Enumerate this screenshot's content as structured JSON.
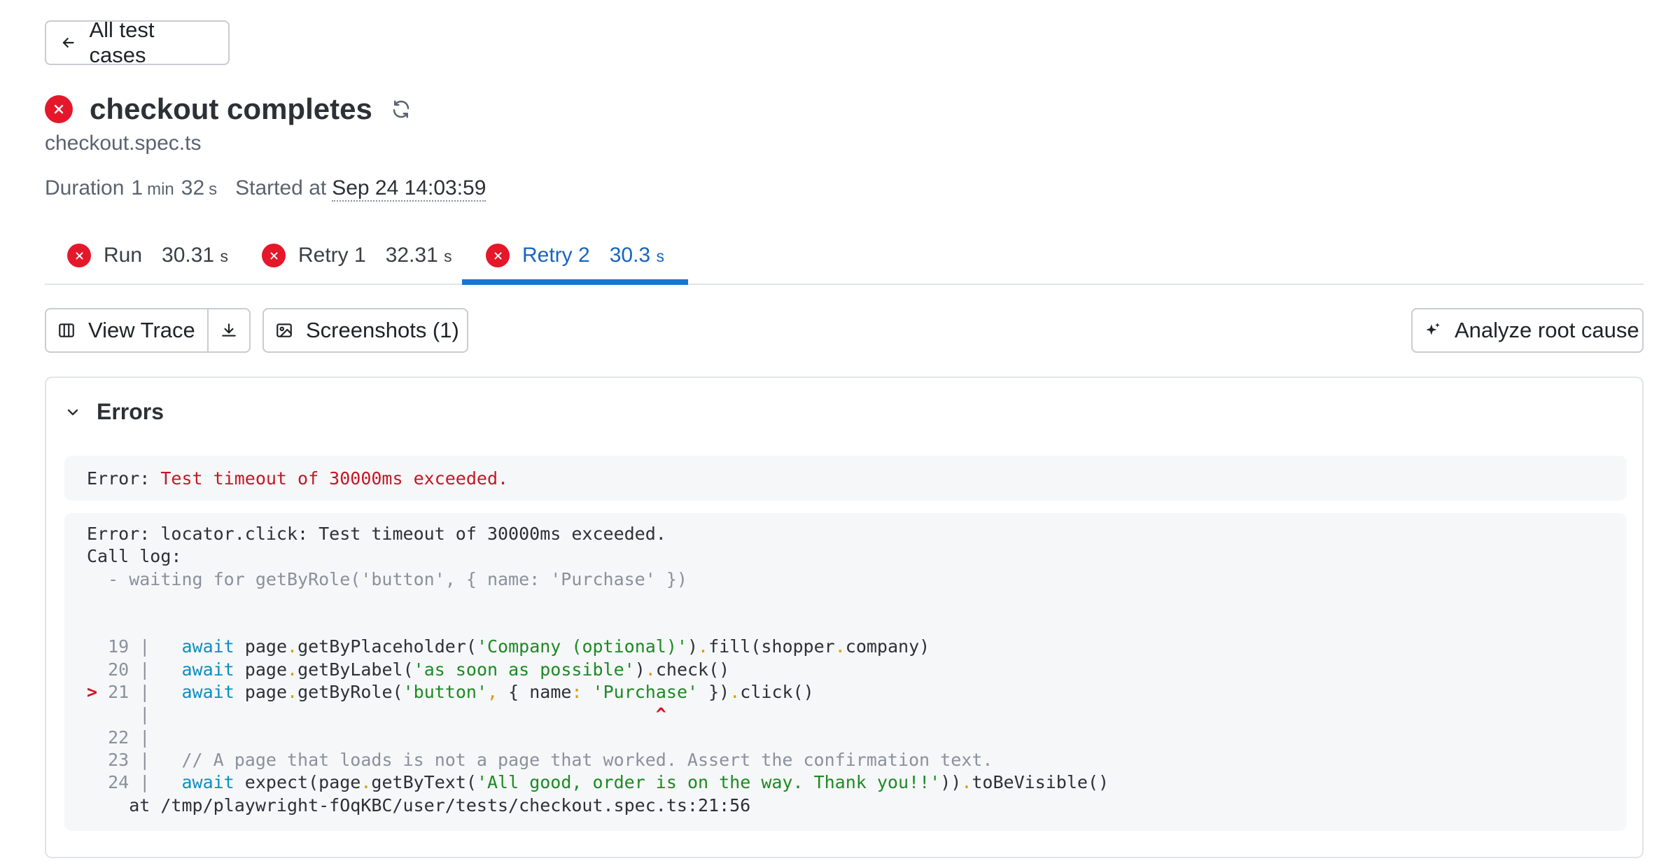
{
  "header": {
    "back_label": "All test cases",
    "title": "checkout completes",
    "file": "checkout.spec.ts",
    "duration_label": "Duration",
    "duration_min": "1",
    "duration_min_unit": "min",
    "duration_sec": "32",
    "duration_sec_unit": "s",
    "started_label": "Started at",
    "started_at": "Sep 24 14:03:59"
  },
  "tabs": [
    {
      "label": "Run",
      "duration": "30.31",
      "unit": "s",
      "active": false
    },
    {
      "label": "Retry 1",
      "duration": "32.31",
      "unit": "s",
      "active": false
    },
    {
      "label": "Retry 2",
      "duration": "30.3",
      "unit": "s",
      "active": true
    }
  ],
  "actions": {
    "view_trace": "View Trace",
    "screenshots": "Screenshots (1)",
    "analyze": "Analyze root cause"
  },
  "errors": {
    "title": "Errors",
    "error1_prefix": "Error: ",
    "error1_message": "Test timeout of 30000ms exceeded.",
    "error2_line1": "Error: locator.click: Test timeout of 30000ms exceeded.",
    "error2_line2": "Call log:",
    "error2_line3": "  - waiting for getByRole('button', { name: 'Purchase' })",
    "code": {
      "l19_num": "  19 |   ",
      "l19_kw": "await",
      "l19_a": " page",
      "l19_b": "getByPlaceholder(",
      "l19_s": "'Company (optional)'",
      "l19_c": ")",
      "l19_d": "fill(shopper",
      "l19_e": "company)",
      "l20_num": "  20 |   ",
      "l20_kw": "await",
      "l20_a": " page",
      "l20_b": "getByLabel(",
      "l20_s": "'as soon as possible'",
      "l20_c": ")",
      "l20_d": "check()",
      "l21_arrow": ">",
      "l21_num": " 21 |   ",
      "l21_kw": "await",
      "l21_a": " page",
      "l21_b": "getByRole(",
      "l21_s": "'button'",
      "l21_comma": ",",
      "l21_c": " { name",
      "l21_colon": ":",
      "l21_s2": " 'Purchase'",
      "l21_d": " })",
      "l21_e": "click()",
      "caret_pad": "     |                                                ",
      "caret": "^",
      "l22": "  22 |",
      "l23_num": "  23 |   ",
      "l23_cmt": "// A page that loads is not a page that worked. Assert the confirmation text.",
      "l24_num": "  24 |   ",
      "l24_kw": "await",
      "l24_a": " expect(page",
      "l24_b": "getByText(",
      "l24_s": "'All good, order is on the way. Thank you!!'",
      "l24_c": "))",
      "l24_d": "toBeVisible()",
      "at_line": "    at /tmp/playwright-fOqKBC/user/tests/checkout.spec.ts:21:56"
    }
  },
  "colors": {
    "fail": "#e5172b",
    "active_tab": "#1976d2"
  }
}
